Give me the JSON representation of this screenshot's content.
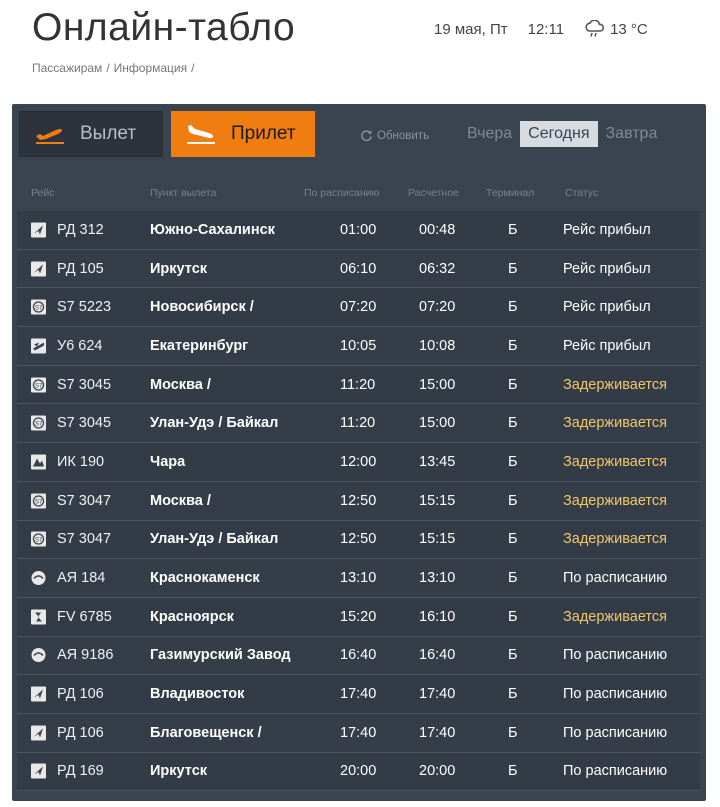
{
  "header": {
    "title": "Онлайн-табло",
    "date": "19 мая, Пт",
    "time": "12:11",
    "temperature": "13 °C",
    "weather_icon": "cloud-rain-icon"
  },
  "breadcrumb": [
    "Пассажирам",
    "Информация"
  ],
  "tabs": {
    "departures": "Вылет",
    "arrivals": "Прилет"
  },
  "refresh_label": "Обновить",
  "day_tabs": [
    "Вчера",
    "Сегодня",
    "Завтра"
  ],
  "active_day": "Сегодня",
  "columns": {
    "flight": "Рейс",
    "origin": "Пункт вылета",
    "scheduled": "По расписанию",
    "estimated": "Расчетное",
    "terminal": "Терминал",
    "status": "Статус"
  },
  "colors": {
    "accent": "#ef7d10",
    "board_bg": "#3a4350",
    "delayed": "#f0c86a"
  },
  "flights": [
    {
      "airline_icon": "rd-airline-icon",
      "flight": "РД 312",
      "city": "Южно-Сахалинск",
      "scheduled": "01:00",
      "estimated": "00:48",
      "terminal": "Б",
      "status": "Рейс прибыл",
      "delayed": false
    },
    {
      "airline_icon": "rd-airline-icon",
      "flight": "РД 105",
      "city": "Иркутск",
      "scheduled": "06:10",
      "estimated": "06:32",
      "terminal": "Б",
      "status": "Рейс прибыл",
      "delayed": false
    },
    {
      "airline_icon": "s7-airline-icon",
      "flight": "S7 5223",
      "city": "Новосибирск /",
      "scheduled": "07:20",
      "estimated": "07:20",
      "terminal": "Б",
      "status": "Рейс прибыл",
      "delayed": false
    },
    {
      "airline_icon": "u6-airline-icon",
      "flight": "У6 624",
      "city": "Екатеринбург",
      "scheduled": "10:05",
      "estimated": "10:08",
      "terminal": "Б",
      "status": "Рейс прибыл",
      "delayed": false
    },
    {
      "airline_icon": "s7-airline-icon",
      "flight": "S7 3045",
      "city": "Москва /",
      "scheduled": "11:20",
      "estimated": "15:00",
      "terminal": "Б",
      "status": "Задерживается",
      "delayed": true
    },
    {
      "airline_icon": "s7-airline-icon",
      "flight": "S7 3045",
      "city": "Улан-Удэ / Байкал",
      "scheduled": "11:20",
      "estimated": "15:00",
      "terminal": "Б",
      "status": "Задерживается",
      "delayed": true
    },
    {
      "airline_icon": "ik-airline-icon",
      "flight": "ИК 190",
      "city": "Чара",
      "scheduled": "12:00",
      "estimated": "13:45",
      "terminal": "Б",
      "status": "Задерживается",
      "delayed": true
    },
    {
      "airline_icon": "s7-airline-icon",
      "flight": "S7 3047",
      "city": "Москва /",
      "scheduled": "12:50",
      "estimated": "15:15",
      "terminal": "Б",
      "status": "Задерживается",
      "delayed": true
    },
    {
      "airline_icon": "s7-airline-icon",
      "flight": "S7 3047",
      "city": "Улан-Удэ / Байкал",
      "scheduled": "12:50",
      "estimated": "15:15",
      "terminal": "Б",
      "status": "Задерживается",
      "delayed": true
    },
    {
      "airline_icon": "aya-airline-icon",
      "flight": "АЯ 184",
      "city": "Краснокаменск",
      "scheduled": "13:10",
      "estimated": "13:10",
      "terminal": "Б",
      "status": "По расписанию",
      "delayed": false
    },
    {
      "airline_icon": "fv-airline-icon",
      "flight": "FV 6785",
      "city": "Красноярск",
      "scheduled": "15:20",
      "estimated": "16:10",
      "terminal": "Б",
      "status": "Задерживается",
      "delayed": true
    },
    {
      "airline_icon": "aya-airline-icon",
      "flight": "АЯ 9186",
      "city": "Газимурский Завод",
      "scheduled": "16:40",
      "estimated": "16:40",
      "terminal": "Б",
      "status": "По расписанию",
      "delayed": false
    },
    {
      "airline_icon": "rd-airline-icon",
      "flight": "РД 106",
      "city": "Владивосток",
      "scheduled": "17:40",
      "estimated": "17:40",
      "terminal": "Б",
      "status": "По расписанию",
      "delayed": false
    },
    {
      "airline_icon": "rd-airline-icon",
      "flight": "РД 106",
      "city": "Благовещенск /",
      "scheduled": "17:40",
      "estimated": "17:40",
      "terminal": "Б",
      "status": "По расписанию",
      "delayed": false
    },
    {
      "airline_icon": "rd-airline-icon",
      "flight": "РД 169",
      "city": "Иркутск",
      "scheduled": "20:00",
      "estimated": "20:00",
      "terminal": "Б",
      "status": "По расписанию",
      "delayed": false
    }
  ]
}
